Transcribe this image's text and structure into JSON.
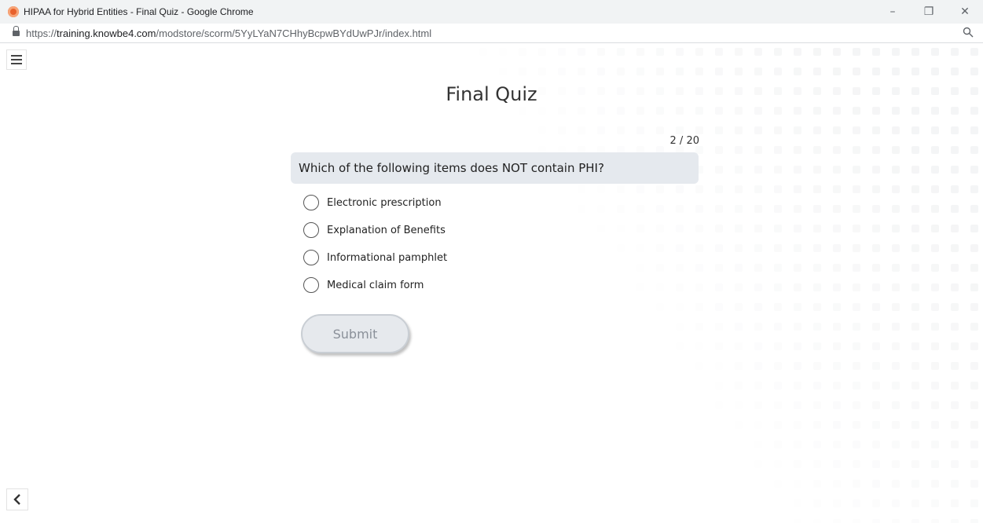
{
  "browser": {
    "window_title": "HIPAA for Hybrid Entities - Final Quiz - Google Chrome",
    "url_protocol": "https://",
    "url_host": "training.knowbe4.com",
    "url_path": "/modstore/scorm/5YyLYaN7CHhyBcpwBYdUwPJr/index.html",
    "controls": {
      "minimize": "–",
      "restore": "❐",
      "close": "✕"
    }
  },
  "quiz": {
    "title": "Final Quiz",
    "counter": "2 / 20",
    "question": "Which of the following items does NOT contain PHI?",
    "options": [
      {
        "label": "Electronic prescription"
      },
      {
        "label": "Explanation of Benefits"
      },
      {
        "label": "Informational pamphlet"
      },
      {
        "label": "Medical claim form"
      }
    ],
    "submit_label": "Submit"
  },
  "icons": {
    "menu": "hamburger-menu-icon",
    "back": "chevron-left-icon",
    "lock": "lock-icon",
    "zoom": "magnifier-icon",
    "favicon": "knowbe4-favicon"
  },
  "colors": {
    "question_bg": "#e5e9ee",
    "submit_bg": "#e6e9ed",
    "submit_text": "#8a9099",
    "favicon": "#e8612c"
  }
}
